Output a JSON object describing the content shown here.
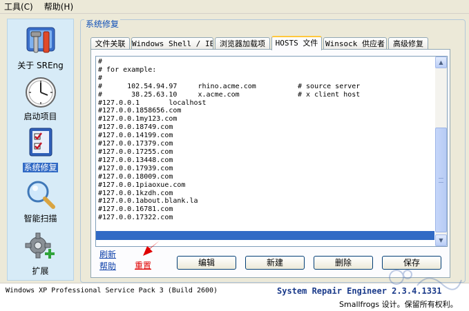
{
  "menu": [
    {
      "label": "工具(C)"
    },
    {
      "label": "帮助(H)"
    }
  ],
  "sidebar": {
    "items": [
      {
        "label": "关于 SREng",
        "icon": "tools-icon"
      },
      {
        "label": "启动项目",
        "icon": "clock-icon"
      },
      {
        "label": "系统修复",
        "icon": "checklist-icon",
        "active": true
      },
      {
        "label": "智能扫描",
        "icon": "magnifier-icon"
      },
      {
        "label": "扩展",
        "icon": "gear-plus-icon"
      }
    ]
  },
  "group_title": "系统修复",
  "tabs": [
    {
      "label": "文件关联"
    },
    {
      "label": "Windows Shell / IE"
    },
    {
      "label": "浏览器加载项"
    },
    {
      "label": "HOSTS 文件",
      "active": true
    },
    {
      "label": "Winsock 供应者"
    },
    {
      "label": "高级修复"
    }
  ],
  "hosts_lines": [
    "#",
    "# for example:",
    "#",
    "#      102.54.94.97     rhino.acme.com          # source server",
    "#       38.25.63.10     x.acme.com              # x client host",
    "#127.0.0.1       localhost",
    "#127.0.0.1858656.com",
    "#127.0.0.1my123.com",
    "#127.0.0.18749.com",
    "#127.0.0.14199.com",
    "#127.0.0.17379.com",
    "#127.0.0.17255.com",
    "#127.0.0.13448.com",
    "#127.0.0.17939.com",
    "#127.0.0.18009.com",
    "#127.0.0.1piaoxue.com",
    "#127.0.0.1kzdh.com",
    "#127.0.0.1about.blank.la",
    "#127.0.0.16781.com",
    "#127.0.0.17322.com"
  ],
  "links": {
    "refresh": "刷新",
    "help": "帮助",
    "reset": "重置"
  },
  "buttons": {
    "edit": "编辑",
    "new": "新建",
    "delete": "删除",
    "save": "保存"
  },
  "status": {
    "os": "Windows XP Professional Service Pack 3 (Build 2600)",
    "product": "System Repair Engineer 2.3.4.1331",
    "copyright": "Smallfrogs 设计。保留所有权利。"
  },
  "colors": {
    "accent_blue": "#316ac5",
    "annotation_red": "#e00000",
    "sidebar_bg": "#d7ebf7"
  }
}
